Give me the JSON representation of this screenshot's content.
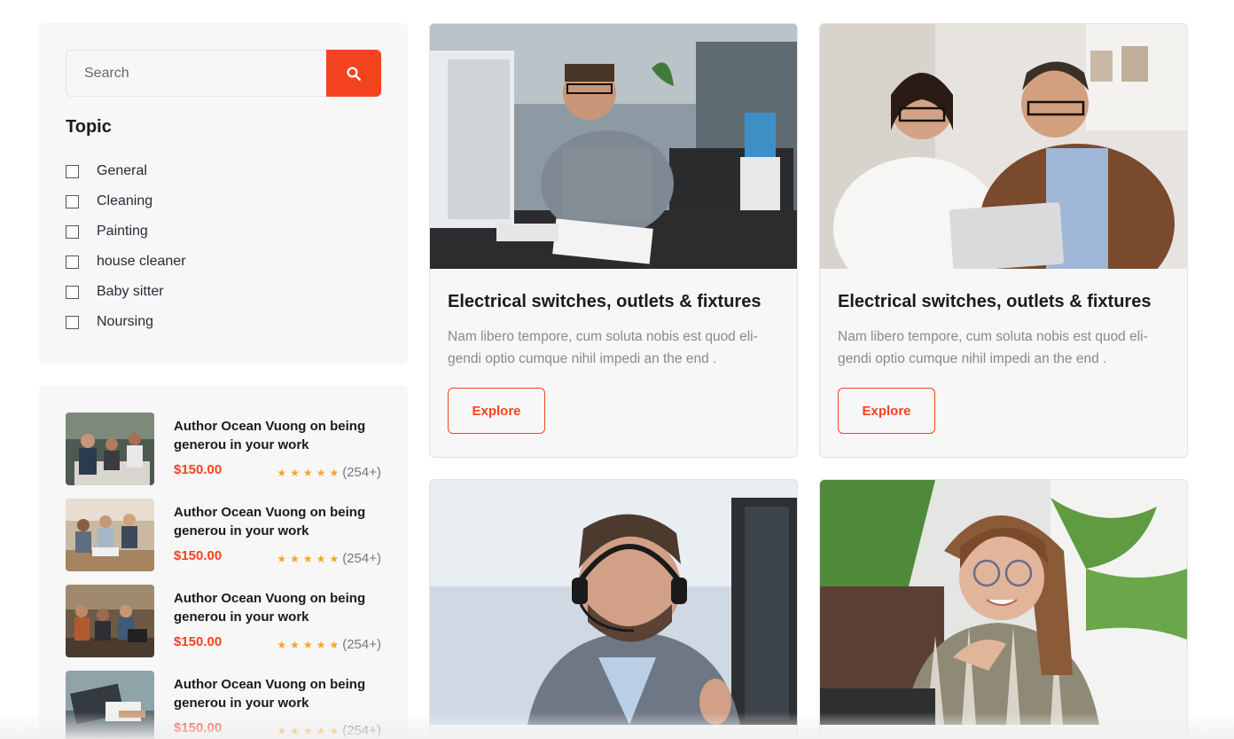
{
  "search": {
    "placeholder": "Search"
  },
  "topics": {
    "title": "Topic",
    "items": [
      "General",
      "Cleaning",
      "Painting",
      "house cleaner",
      "Baby sitter",
      "Noursing"
    ]
  },
  "posts": [
    {
      "title": "Author Ocean Vuong on being generou in your work",
      "price": "$150.00",
      "rating": 5,
      "count": "(254+)"
    },
    {
      "title": "Author Ocean Vuong on being generou in your work",
      "price": "$150.00",
      "rating": 5,
      "count": "(254+)"
    },
    {
      "title": "Author Ocean Vuong on being generou in your work",
      "price": "$150.00",
      "rating": 5,
      "count": "(254+)"
    },
    {
      "title": "Author Ocean Vuong on being generou in your work",
      "price": "$150.00",
      "rating": 5,
      "count": "(254+)"
    }
  ],
  "cards": [
    {
      "title": "Electrical switches, outlets & fixtures",
      "text": "Nam libero tempore, cum soluta nobis est quod eli-gendi optio cumque nihil impedi an the end .",
      "button": "Explore"
    },
    {
      "title": "Electrical switches, outlets & fixtures",
      "text": "Nam libero tempore, cum soluta nobis est quod eli-gendi optio cumque nihil impedi an the end .",
      "button": "Explore"
    }
  ],
  "colors": {
    "accent": "#f4431f",
    "star": "#f5a623",
    "panel": "#f7f7f7"
  },
  "icons": {
    "search": "search-icon",
    "star": "star-icon"
  }
}
